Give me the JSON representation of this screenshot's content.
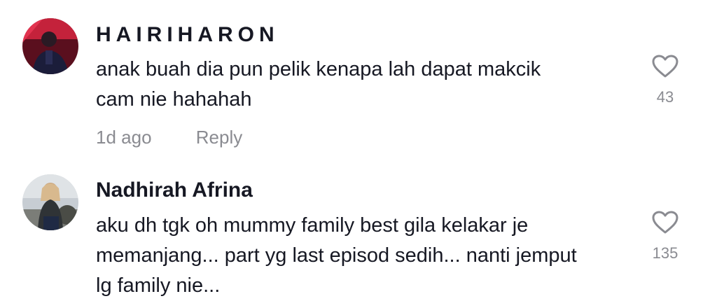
{
  "comments": [
    {
      "username": "HAIRIHARON",
      "text_line1": "anak buah dia pun pelik kenapa lah dapat makcik",
      "text_line2": "cam nie hahahah",
      "time": "1d ago",
      "reply_label": "Reply",
      "likes": "43",
      "avatar_icon": "user-avatar-dark-red"
    },
    {
      "username": "Nadhirah Afrina",
      "text_line1": "aku dh tgk oh mummy family best gila kelakar je",
      "text_line2": "memanjang... part yg last episod sedih... nanti jemput",
      "text_line3": "lg family nie...",
      "likes": "135",
      "avatar_icon": "user-avatar-outdoor-photo"
    }
  ],
  "colors": {
    "primary_text": "#161823",
    "secondary_text": "#8a8b91",
    "background": "#ffffff"
  }
}
